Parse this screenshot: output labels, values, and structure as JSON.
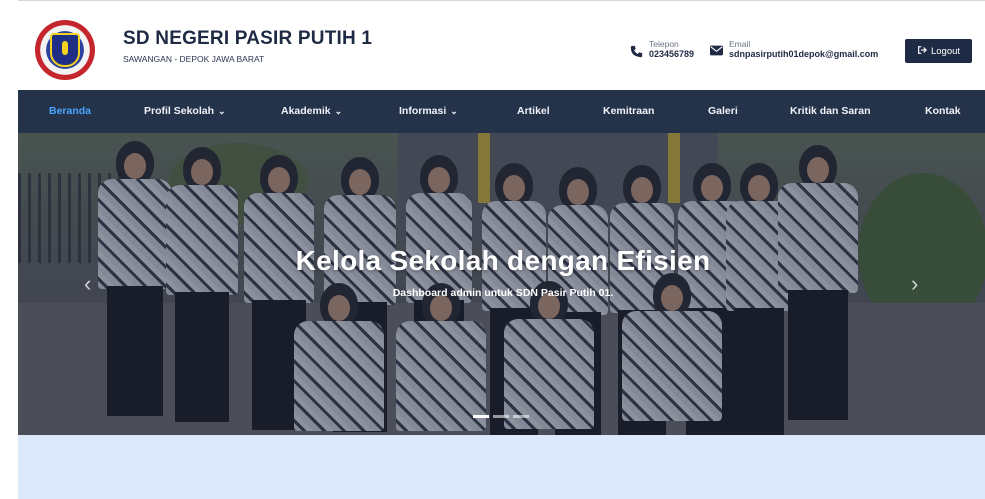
{
  "header": {
    "school_name": "SD NEGERI PASIR PUTIH 1",
    "school_location": "SAWANGAN - DEPOK JAWA BARAT",
    "phone_label": "Telepon",
    "phone_value": "023456789",
    "email_label": "Email",
    "email_value": "sdnpasirputih01depok@gmail.com",
    "logout_label": "Logout",
    "logout_icon": "logout-icon",
    "phone_icon": "phone-icon",
    "email_icon": "envelope-icon"
  },
  "nav": {
    "items": [
      {
        "label": "Beranda",
        "active": true
      },
      {
        "label": "Profil Sekolah",
        "dropdown": true
      },
      {
        "label": "Akademik",
        "dropdown": true
      },
      {
        "label": "Informasi",
        "dropdown": true
      },
      {
        "label": "Artikel"
      },
      {
        "label": "Kemitraan"
      },
      {
        "label": "Galeri"
      },
      {
        "label": "Kritik dan Saran"
      },
      {
        "label": "Kontak"
      }
    ],
    "caret": "⌄",
    "active_color": "#4aa6ff",
    "bg_color": "#24324a"
  },
  "hero": {
    "title": "Kelola Sekolah dengan Efisien",
    "subtitle": "Dashboard admin untuk SDN Pasir Putih 01.",
    "prev_glyph": "‹",
    "next_glyph": "›",
    "slides": 3,
    "active_slide": 1
  },
  "colors": {
    "primary": "#1f2a44",
    "section_bg": "#dbe9fb"
  }
}
